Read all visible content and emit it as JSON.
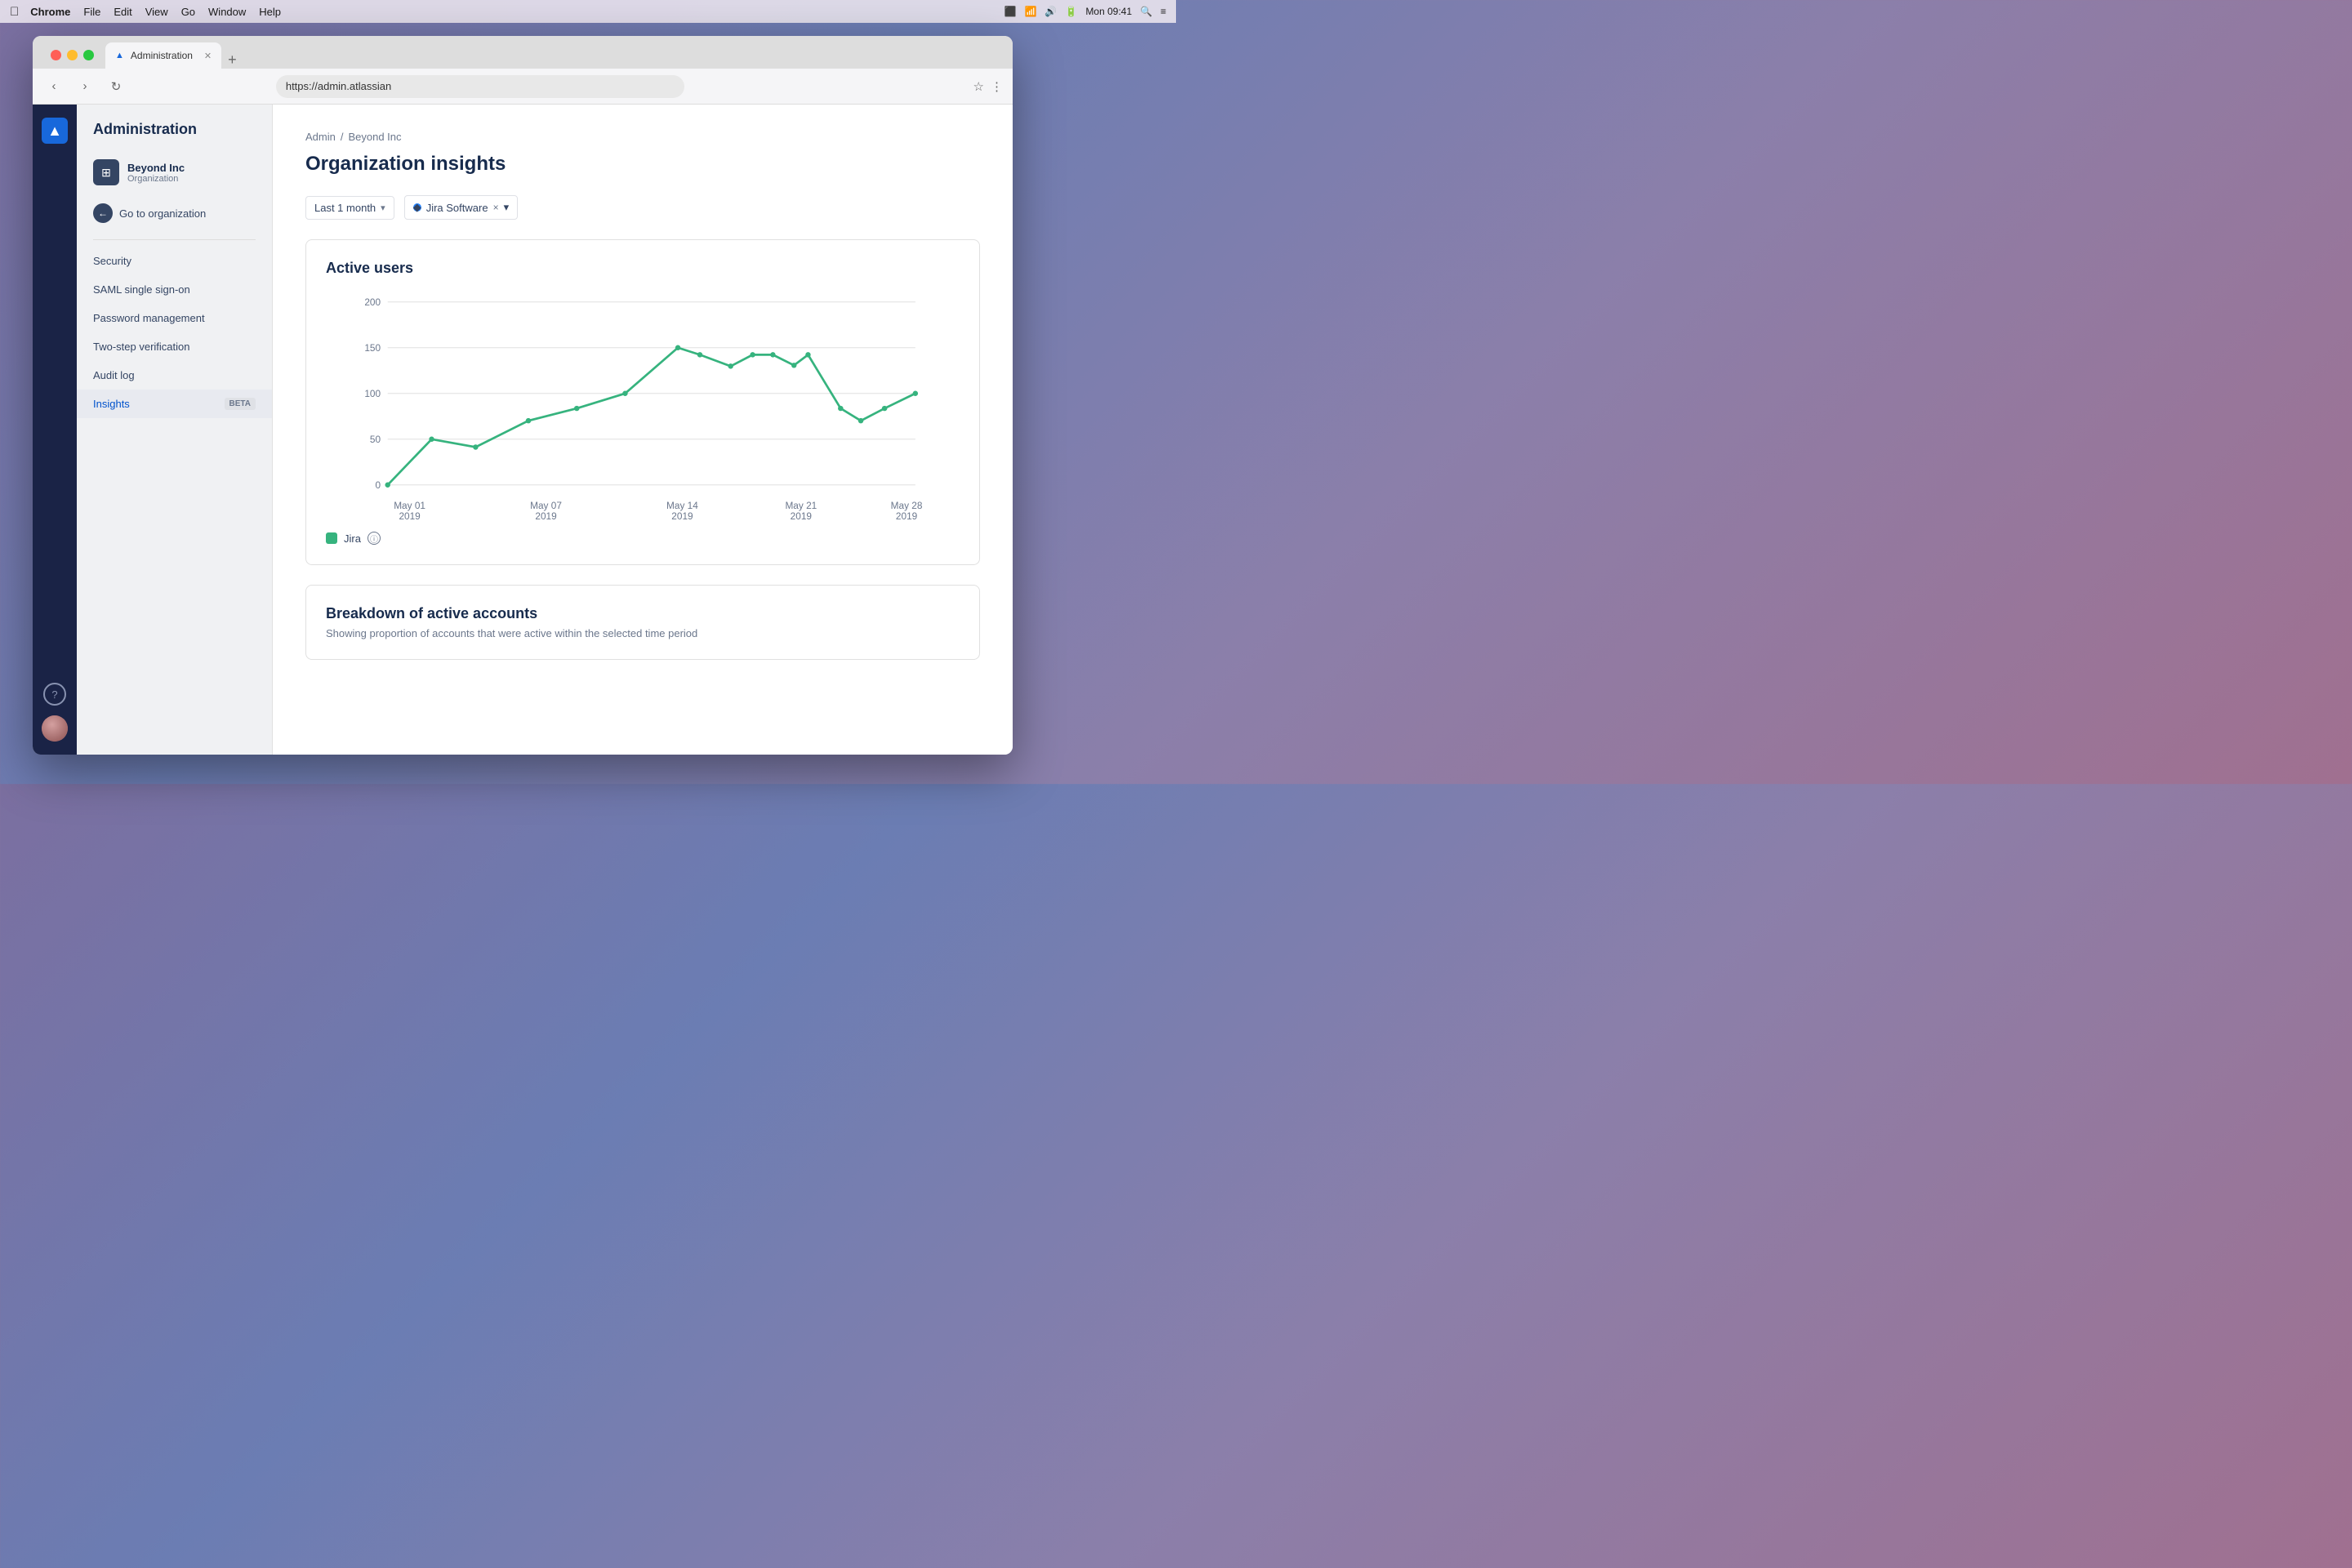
{
  "os": {
    "time": "Mon 09:41",
    "menu": [
      "Apple",
      "Chrome",
      "File",
      "Edit",
      "View",
      "Go",
      "Window",
      "Help"
    ]
  },
  "browser": {
    "tab_title": "Administration",
    "url": "https://admin.atlassian",
    "tab_icon": "▲"
  },
  "sidebar_dark": {
    "logo": "▲",
    "help_label": "?",
    "avatar_alt": "user avatar"
  },
  "sidebar_nav": {
    "title": "Administration",
    "org": {
      "name": "Beyond Inc",
      "type": "Organization",
      "icon": "⊞"
    },
    "goto_org": "Go to organization",
    "items": [
      {
        "label": "Security",
        "active": false
      },
      {
        "label": "SAML single sign-on",
        "active": false
      },
      {
        "label": "Password management",
        "active": false
      },
      {
        "label": "Two-step verification",
        "active": false
      },
      {
        "label": "Audit log",
        "active": false
      },
      {
        "label": "Insights",
        "active": true,
        "badge": "BETA"
      }
    ]
  },
  "breadcrumb": {
    "admin": "Admin",
    "separator": "/",
    "current": "Beyond Inc"
  },
  "main": {
    "title": "Organization insights",
    "filter_time": "Last 1 month",
    "filter_product_name": "Jira Software",
    "filter_chevron": "▾",
    "filter_x": "×"
  },
  "chart": {
    "title": "Active users",
    "y_labels": [
      "200",
      "150",
      "100",
      "50",
      "0"
    ],
    "x_labels": [
      {
        "line1": "May 01",
        "line2": "2019"
      },
      {
        "line1": "May 07",
        "line2": "2019"
      },
      {
        "line1": "May 14",
        "line2": "2019"
      },
      {
        "line1": "May 21",
        "line2": "2019"
      },
      {
        "line1": "May 28",
        "line2": "2019"
      }
    ],
    "legend_label": "Jira",
    "legend_color": "#36b37e",
    "data_points": [
      0,
      50,
      45,
      70,
      85,
      100,
      140,
      130,
      115,
      130,
      130,
      115,
      130,
      85,
      70,
      85,
      100
    ]
  },
  "breakdown": {
    "title": "Breakdown of active accounts",
    "subtitle": "Showing proportion of accounts that were active within the selected time period"
  }
}
